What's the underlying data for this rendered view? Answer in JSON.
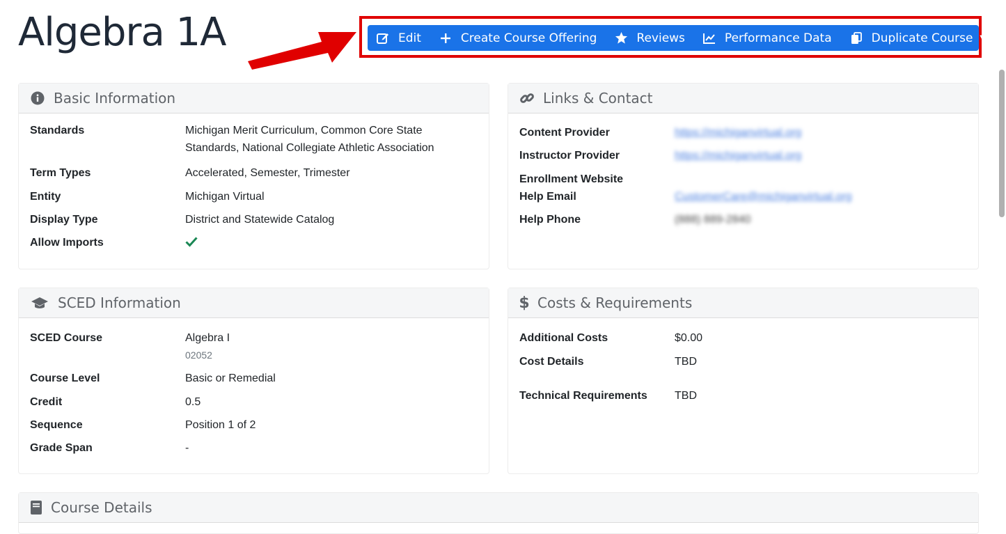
{
  "page": {
    "title": "Algebra 1A"
  },
  "toolbar": {
    "edit": "Edit",
    "create_offering": "Create Course Offering",
    "reviews": "Reviews",
    "performance": "Performance Data",
    "duplicate": "Duplicate Course",
    "color": "#1a73e8"
  },
  "basic": {
    "title": "Basic Information",
    "standards_label": "Standards",
    "standards_line1": "Michigan Merit Curriculum, Common Core State",
    "standards_line2": "Standards, National Collegiate Athletic Association",
    "term_label": "Term Types",
    "term_value": "Accelerated, Semester, Trimester",
    "entity_label": "Entity",
    "entity_value": "Michigan Virtual",
    "display_label": "Display Type",
    "display_value": "District and Statewide Catalog",
    "imports_label": "Allow Imports",
    "imports_icon": "check-icon"
  },
  "links": {
    "title": "Links & Contact",
    "content_label": "Content Provider",
    "content_value": "https://michiganvirtual.org",
    "instructor_label": "Instructor Provider",
    "instructor_value": "https://michiganvirtual.org",
    "enroll_label": "Enrollment Website",
    "email_label": "Help Email",
    "email_value": "CustomerCare@michiganvirtual.org",
    "phone_label": "Help Phone",
    "phone_value": "(888) 889-2840"
  },
  "sced": {
    "title": "SCED Information",
    "course_label": "SCED Course",
    "course_value": "Algebra I",
    "course_code": "02052",
    "level_label": "Course Level",
    "level_value": "Basic or Remedial",
    "credit_label": "Credit",
    "credit_value": "0.5",
    "sequence_label": "Sequence",
    "sequence_value": "Position 1 of 2",
    "grade_label": "Grade Span",
    "grade_value": "-"
  },
  "costs": {
    "title": "Costs & Requirements",
    "additional_label": "Additional Costs",
    "additional_value": "$0.00",
    "details_label": "Cost Details",
    "details_value": "TBD",
    "tech_label": "Technical Requirements",
    "tech_value": "TBD"
  },
  "details": {
    "title": "Course Details"
  }
}
